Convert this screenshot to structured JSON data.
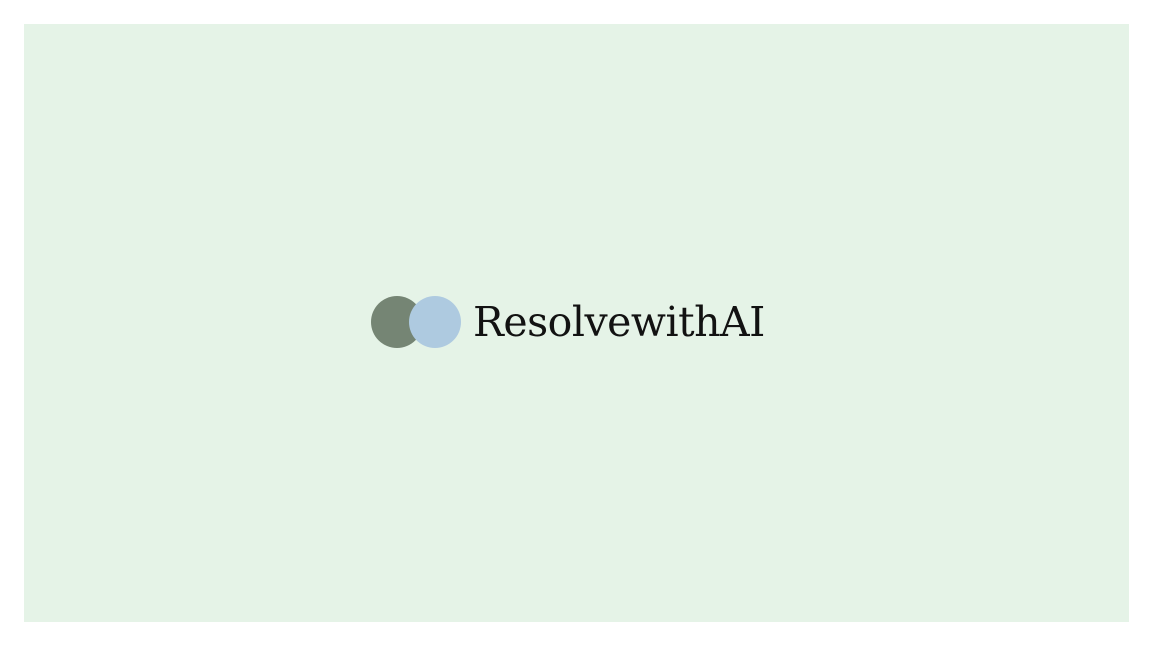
{
  "brand": {
    "name": "ResolvewithAI",
    "colors": {
      "background": "#e5f3e7",
      "circle_left": "#758574",
      "circle_right": "#aecae0",
      "text": "#121212"
    }
  }
}
